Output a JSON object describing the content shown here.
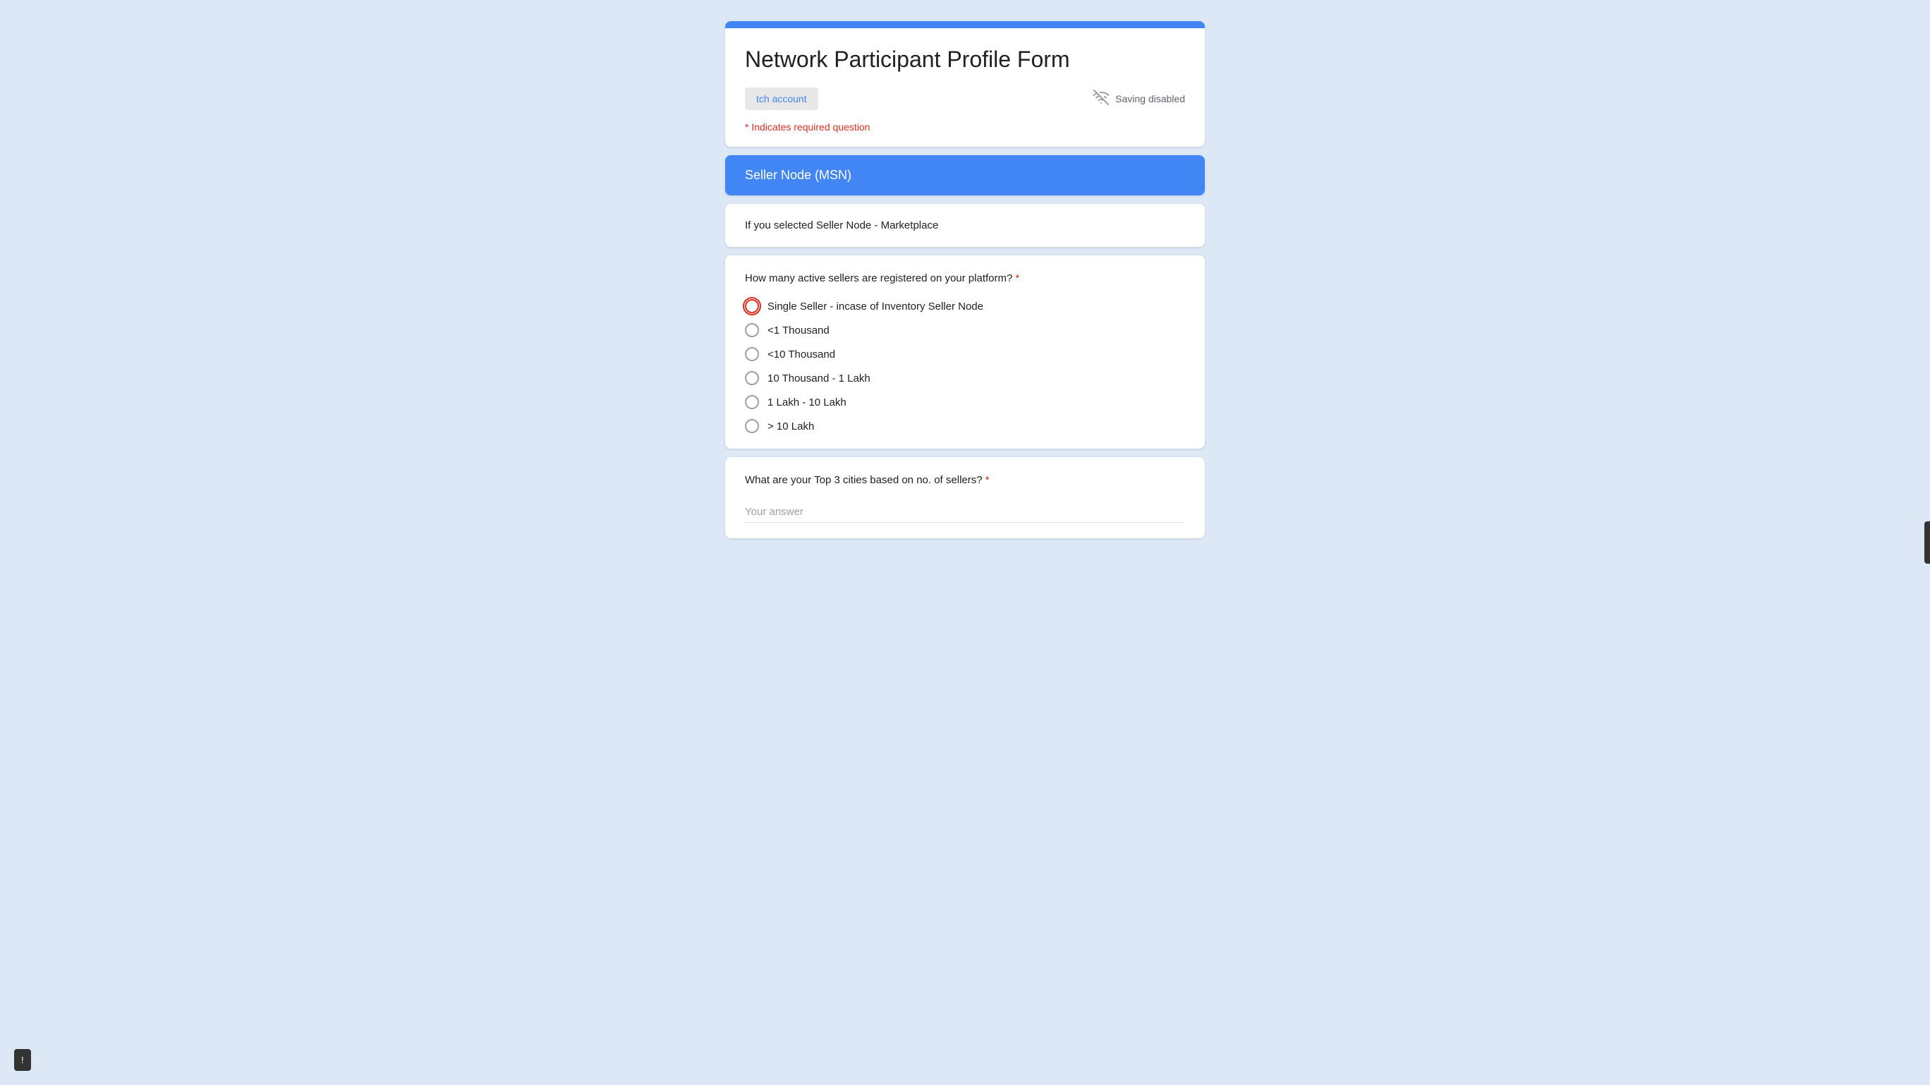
{
  "form": {
    "title": "Network Participant Profile Form",
    "border_color": "#4285f4",
    "switch_account_label": "tch account",
    "saving_status": "Saving disabled",
    "required_note": "* Indicates required question"
  },
  "section": {
    "title": "Seller Node (MSN)"
  },
  "info": {
    "text": "If you selected Seller Node - Marketplace"
  },
  "question1": {
    "label": "How many active sellers are registered on your platform?",
    "required": true,
    "options": [
      {
        "id": "opt1",
        "label": "Single Seller - incase of Inventory Seller Node",
        "highlighted": true
      },
      {
        "id": "opt2",
        "label": "<1 Thousand",
        "highlighted": false
      },
      {
        "id": "opt3",
        "label": "<10 Thousand",
        "highlighted": false
      },
      {
        "id": "opt4",
        "label": "10 Thousand - 1 Lakh",
        "highlighted": false
      },
      {
        "id": "opt5",
        "label": "1 Lakh - 10 Lakh",
        "highlighted": false
      },
      {
        "id": "opt6",
        "label": "> 10 Lakh",
        "highlighted": false
      }
    ]
  },
  "question2": {
    "label": "What are your Top 3 cities based on no. of sellers?",
    "required": true,
    "placeholder": "Your answer"
  },
  "icons": {
    "cloud_off": "cloud-off",
    "exclamation": "!"
  }
}
